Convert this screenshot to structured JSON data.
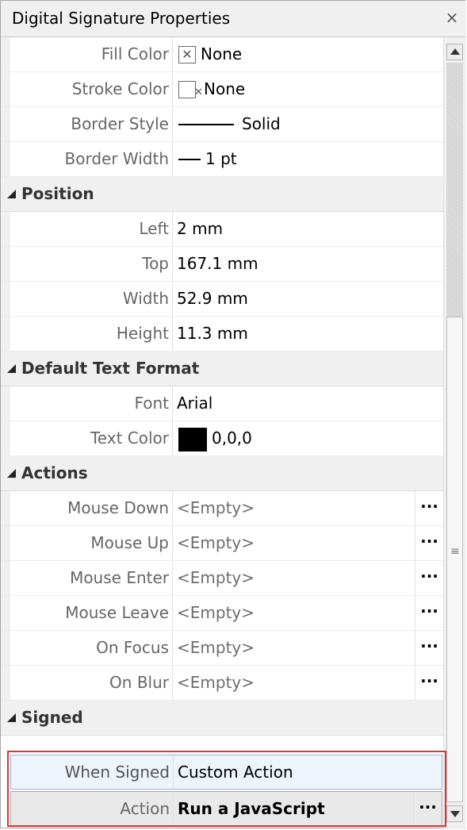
{
  "window": {
    "title": "Digital Signature Properties",
    "close_glyph": "×"
  },
  "appearance": {
    "fill_color": {
      "label": "Fill Color",
      "value": "None",
      "icon": "no-color-swatch-icon"
    },
    "stroke_color": {
      "label": "Stroke Color",
      "value": "None",
      "icon": "no-color-swatch-icon"
    },
    "border_style": {
      "label": "Border Style",
      "value": "Solid"
    },
    "border_width": {
      "label": "Border Width",
      "value": "1 pt"
    }
  },
  "position": {
    "header": "Position",
    "left": {
      "label": "Left",
      "value": "2 mm"
    },
    "top": {
      "label": "Top",
      "value": "167.1 mm"
    },
    "width": {
      "label": "Width",
      "value": "52.9 mm"
    },
    "height": {
      "label": "Height",
      "value": "11.3 mm"
    }
  },
  "text_format": {
    "header": "Default Text Format",
    "font": {
      "label": "Font",
      "value": "Arial"
    },
    "text_color": {
      "label": "Text Color",
      "value": "0,0,0",
      "swatch": "#000000"
    }
  },
  "actions": {
    "header": "Actions",
    "ellipsis": "···",
    "items": [
      {
        "label": "Mouse Down",
        "value": "<Empty>"
      },
      {
        "label": "Mouse Up",
        "value": "<Empty>"
      },
      {
        "label": "Mouse Enter",
        "value": "<Empty>"
      },
      {
        "label": "Mouse Leave",
        "value": "<Empty>"
      },
      {
        "label": "On Focus",
        "value": "<Empty>"
      },
      {
        "label": "On Blur",
        "value": "<Empty>"
      }
    ]
  },
  "signed": {
    "header": "Signed",
    "when_signed": {
      "label": "When Signed",
      "value": "Custom Action"
    },
    "action": {
      "label": "Action",
      "value": "Run a JavaScript"
    }
  },
  "colors": {
    "highlight_border": "#e03030",
    "selected_row": "#eef4fb"
  }
}
